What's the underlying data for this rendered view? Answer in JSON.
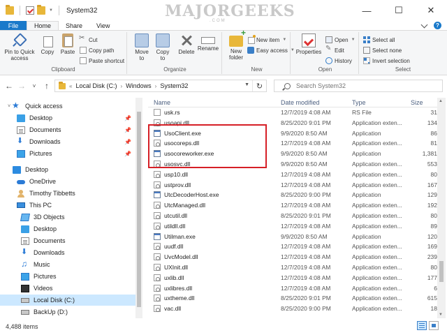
{
  "window": {
    "title": "System32",
    "watermark": "MAJORGEEKS",
    "watermark_sub": ".COM",
    "controls": {
      "minimize": "—",
      "maximize": "☐",
      "close": "✕"
    }
  },
  "ribbon_tabs": [
    "File",
    "Home",
    "Share",
    "View"
  ],
  "ribbon": {
    "clipboard": {
      "label": "Clipboard",
      "pin": "Pin to Quick access",
      "copy": "Copy",
      "paste": "Paste",
      "cut": "Cut",
      "copy_path": "Copy path",
      "paste_shortcut": "Paste shortcut"
    },
    "organize": {
      "label": "Organize",
      "move_to": "Move to",
      "copy_to": "Copy to",
      "delete": "Delete",
      "rename": "Rename"
    },
    "new": {
      "label": "New",
      "new_folder": "New folder",
      "new_item": "New item",
      "easy_access": "Easy access"
    },
    "open": {
      "label": "Open",
      "properties": "Properties",
      "open": "Open",
      "edit": "Edit",
      "history": "History"
    },
    "select": {
      "label": "Select",
      "select_all": "Select all",
      "select_none": "Select none",
      "invert": "Invert selection"
    }
  },
  "address": {
    "crumbs": [
      "Local Disk (C:)",
      "Windows",
      "System32"
    ],
    "search_placeholder": "Search System32"
  },
  "nav": {
    "quick_access": "Quick access",
    "qa_items": [
      "Desktop",
      "Documents",
      "Downloads",
      "Pictures"
    ],
    "desktop": "Desktop",
    "onedrive": "OneDrive",
    "user": "Timothy Tibbetts",
    "this_pc": "This PC",
    "pc_items": [
      "3D Objects",
      "Desktop",
      "Documents",
      "Downloads",
      "Music",
      "Pictures",
      "Videos",
      "Local Disk (C:)",
      "BackUp (D:)"
    ]
  },
  "columns": {
    "name": "Name",
    "date": "Date modified",
    "type": "Type",
    "size": "Size"
  },
  "files": [
    {
      "name": "usk.rs",
      "date": "12/7/2019 4:08 AM",
      "type": "RS File",
      "size": "31",
      "icon": "rs"
    },
    {
      "name": "usoapi.dll",
      "date": "8/25/2020 9:01 PM",
      "type": "Application exten...",
      "size": "134",
      "icon": "dll"
    },
    {
      "name": "UsoClient.exe",
      "date": "9/9/2020 8:50 AM",
      "type": "Application",
      "size": "86",
      "icon": "exe"
    },
    {
      "name": "usocoreps.dll",
      "date": "12/7/2019 4:08 AM",
      "type": "Application exten...",
      "size": "81",
      "icon": "dll"
    },
    {
      "name": "usocoreworker.exe",
      "date": "9/9/2020 8:50 AM",
      "type": "Application",
      "size": "1,381",
      "icon": "exe"
    },
    {
      "name": "usosvc.dll",
      "date": "9/9/2020 8:50 AM",
      "type": "Application exten...",
      "size": "553",
      "icon": "dll"
    },
    {
      "name": "usp10.dll",
      "date": "12/7/2019 4:08 AM",
      "type": "Application exten...",
      "size": "80",
      "icon": "dll"
    },
    {
      "name": "ustprov.dll",
      "date": "12/7/2019 4:08 AM",
      "type": "Application exten...",
      "size": "167",
      "icon": "dll"
    },
    {
      "name": "UtcDecoderHost.exe",
      "date": "8/25/2020 9:00 PM",
      "type": "Application",
      "size": "129",
      "icon": "exe"
    },
    {
      "name": "UtcManaged.dll",
      "date": "12/7/2019 4:08 AM",
      "type": "Application exten...",
      "size": "192",
      "icon": "dll"
    },
    {
      "name": "utcutil.dll",
      "date": "8/25/2020 9:01 PM",
      "type": "Application exten...",
      "size": "80",
      "icon": "dll"
    },
    {
      "name": "utildll.dll",
      "date": "12/7/2019 4:08 AM",
      "type": "Application exten...",
      "size": "89",
      "icon": "dll"
    },
    {
      "name": "Utilman.exe",
      "date": "9/9/2020 8:50 AM",
      "type": "Application",
      "size": "120",
      "icon": "exe"
    },
    {
      "name": "uudf.dll",
      "date": "12/7/2019 4:08 AM",
      "type": "Application exten...",
      "size": "169",
      "icon": "dll"
    },
    {
      "name": "UvcModel.dll",
      "date": "12/7/2019 4:08 AM",
      "type": "Application exten...",
      "size": "239",
      "icon": "dll"
    },
    {
      "name": "UXInit.dll",
      "date": "12/7/2019 4:08 AM",
      "type": "Application exten...",
      "size": "80",
      "icon": "dll"
    },
    {
      "name": "uxlib.dll",
      "date": "12/7/2019 4:08 AM",
      "type": "Application exten...",
      "size": "177",
      "icon": "dll"
    },
    {
      "name": "uxlibres.dll",
      "date": "12/7/2019 4:08 AM",
      "type": "Application exten...",
      "size": "6",
      "icon": "dll"
    },
    {
      "name": "uxtheme.dll",
      "date": "8/25/2020 9:01 PM",
      "type": "Application exten...",
      "size": "615",
      "icon": "dll"
    },
    {
      "name": "vac.dll",
      "date": "8/25/2020 9:00 PM",
      "type": "Application exten...",
      "size": "18",
      "icon": "dll"
    }
  ],
  "status": {
    "count": "4,488 items"
  }
}
